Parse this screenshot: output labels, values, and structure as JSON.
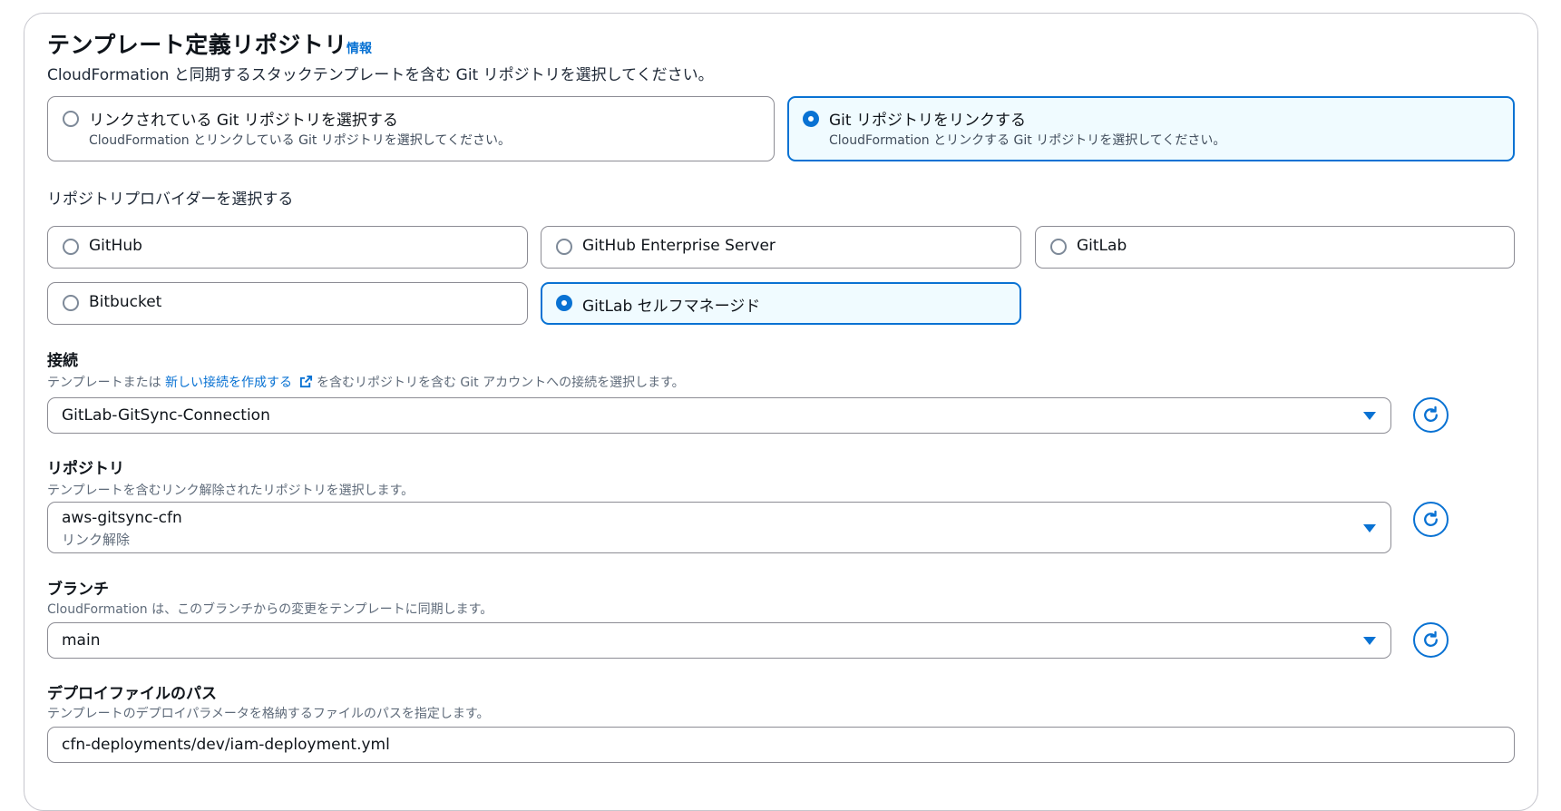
{
  "header": {
    "title": "テンプレート定義リポジトリ",
    "info_link": "情報",
    "description": "CloudFormation と同期するスタックテンプレートを含む Git リポジトリを選択してください。"
  },
  "repo_mode": {
    "options": [
      {
        "label": "リンクされている Git リポジトリを選択する",
        "sub": "CloudFormation とリンクしている Git リポジトリを選択してください。",
        "selected": false
      },
      {
        "label": "Git リポジトリをリンクする",
        "sub": "CloudFormation とリンクする Git リポジトリを選択してください。",
        "selected": true
      }
    ]
  },
  "provider": {
    "label": "リポジトリプロバイダーを選択する",
    "options": [
      {
        "label": "GitHub",
        "selected": false
      },
      {
        "label": "GitHub Enterprise Server",
        "selected": false
      },
      {
        "label": "GitLab",
        "selected": false
      },
      {
        "label": "Bitbucket",
        "selected": false
      },
      {
        "label": "GitLab セルフマネージド",
        "selected": true
      }
    ]
  },
  "connection": {
    "label": "接続",
    "desc_prefix": "テンプレートまたは",
    "desc_link": "新しい接続を作成する",
    "desc_suffix": "を含むリポジトリを含む Git アカウントへの接続を選択します。",
    "value": "GitLab-GitSync-Connection"
  },
  "repository": {
    "label": "リポジトリ",
    "description": "テンプレートを含むリンク解除されたリポジトリを選択します。",
    "value": "aws-gitsync-cfn",
    "value_sub": "リンク解除"
  },
  "branch": {
    "label": "ブランチ",
    "description": "CloudFormation は、このブランチからの変更をテンプレートに同期します。",
    "value": "main"
  },
  "deploy_file": {
    "label": "デプロイファイルのパス",
    "description": "テンプレートのデプロイパラメータを格納するファイルのパスを指定します。",
    "value": "cfn-deployments/dev/iam-deployment.yml"
  },
  "colors": {
    "accent": "#0972d3",
    "selected_bg": "#f0fbff",
    "border": "#8c8c94"
  },
  "icons": {
    "refresh": "refresh-icon",
    "external_link": "external-link-icon",
    "caret": "caret-down-icon"
  }
}
